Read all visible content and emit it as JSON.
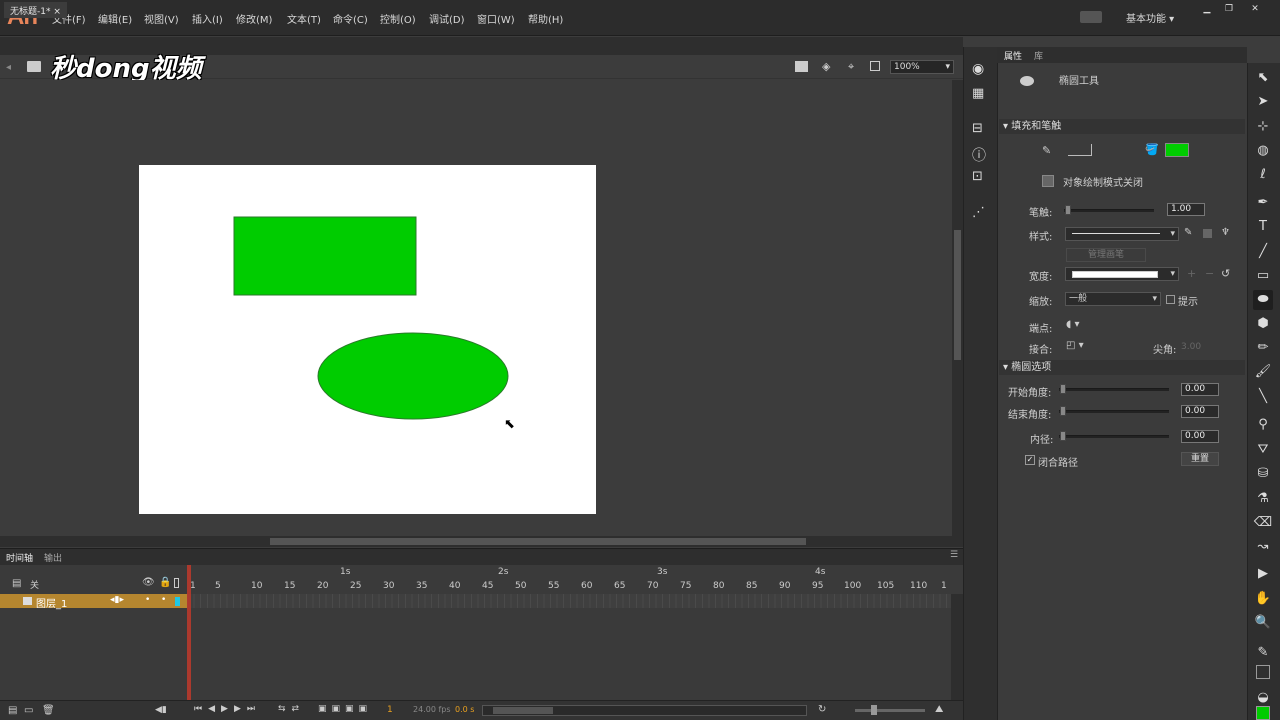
{
  "app": {
    "logo": "An"
  },
  "menu": [
    "文件(F)",
    "编辑(E)",
    "视图(V)",
    "插入(I)",
    "修改(M)",
    "文本(T)",
    "命令(C)",
    "控制(O)",
    "调试(D)",
    "窗口(W)",
    "帮助(H)"
  ],
  "workspace": "基本功能",
  "document_tab": "无标题-1*",
  "zoom": "100%",
  "watermark": "秒dong视频",
  "colors": {
    "fill": "#00cc00",
    "stage": "#ffffff",
    "layer_highlight": "#b5862f",
    "playhead": "#c0392b"
  },
  "timeline": {
    "tabs": [
      "时间轴",
      "输出"
    ],
    "header_label": "关",
    "layer_name": "图层_1",
    "seconds": [
      "1s",
      "2s",
      "3s",
      "4s"
    ],
    "frame_numbers": [
      "1",
      "5",
      "10",
      "15",
      "20",
      "25",
      "30",
      "35",
      "40",
      "45",
      "50",
      "55",
      "60",
      "65",
      "70",
      "75",
      "80",
      "85",
      "90",
      "95",
      "100",
      "105",
      "110",
      "1"
    ],
    "current_frame": "1",
    "fps": "24.00 fps",
    "time": "0.0 s"
  },
  "properties": {
    "tabs": [
      "属性",
      "库"
    ],
    "tool_name": "椭圆工具",
    "section_fill_stroke": "填充和笔触",
    "object_draw_mode": "对象绘制模式关闭",
    "stroke_label": "笔触:",
    "stroke_value": "1.00",
    "style_label": "样式:",
    "manage_brush": "管理画笔",
    "width_label": "宽度:",
    "scale_label": "缩放:",
    "scale_value": "一般",
    "hint_label": "提示",
    "cap_label": "端点:",
    "join_label": "接合:",
    "miter_label": "尖角:",
    "miter_value": "3.00",
    "section_oval": "椭圆选项",
    "start_angle_label": "开始角度:",
    "start_angle": "0.00",
    "end_angle_label": "结束角度:",
    "end_angle": "0.00",
    "inner_radius_label": "内径:",
    "inner_radius": "0.00",
    "close_path_label": "闭合路径",
    "reset_button": "重置"
  }
}
